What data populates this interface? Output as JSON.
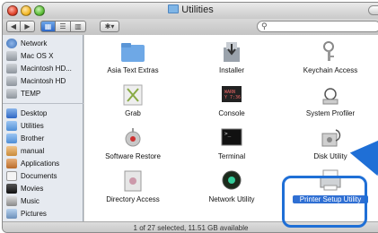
{
  "window": {
    "title": "Utilities"
  },
  "toolbar": {
    "action_label": "✱▾",
    "search_placeholder": ""
  },
  "sidebar": {
    "devices": [
      {
        "label": "Network",
        "icon": "globe-icon"
      },
      {
        "label": "Mac OS X",
        "icon": "hard-drive-icon"
      },
      {
        "label": "Macintosh HD...",
        "icon": "hard-drive-icon"
      },
      {
        "label": "Macintosh HD",
        "icon": "hard-drive-icon"
      },
      {
        "label": "TEMP",
        "icon": "hard-drive-icon"
      }
    ],
    "places": [
      {
        "label": "Desktop",
        "icon": "desktop-icon"
      },
      {
        "label": "Utilities",
        "icon": "folder-icon"
      },
      {
        "label": "Brother",
        "icon": "folder-icon"
      },
      {
        "label": "manual",
        "icon": "home-icon"
      },
      {
        "label": "Applications",
        "icon": "applications-icon"
      },
      {
        "label": "Documents",
        "icon": "documents-icon"
      },
      {
        "label": "Movies",
        "icon": "movies-icon"
      },
      {
        "label": "Music",
        "icon": "music-icon"
      },
      {
        "label": "Pictures",
        "icon": "pictures-icon"
      }
    ]
  },
  "items": [
    {
      "label": "Asia Text Extras",
      "icon": "folder-icon"
    },
    {
      "label": "Installer",
      "icon": "installer-icon"
    },
    {
      "label": "Keychain Access",
      "icon": "keychain-icon"
    },
    {
      "label": "Grab",
      "icon": "grab-icon"
    },
    {
      "label": "Console",
      "icon": "console-icon"
    },
    {
      "label": "System Profiler",
      "icon": "system-profiler-icon"
    },
    {
      "label": "Software Restore",
      "icon": "software-restore-icon"
    },
    {
      "label": "Terminal",
      "icon": "terminal-icon"
    },
    {
      "label": "Disk Utility",
      "icon": "disk-utility-icon"
    },
    {
      "label": "Directory Access",
      "icon": "directory-access-icon"
    },
    {
      "label": "Network Utility",
      "icon": "network-utility-icon"
    },
    {
      "label": "Printer Setup Utility",
      "icon": "printer-icon"
    }
  ],
  "status": {
    "text": "1 of 27 selected, 11.51 GB available"
  },
  "colors": {
    "accent": "#1f6fd6",
    "selection": "#2f6fd3",
    "sidebar_bg": "#e6eaf0"
  }
}
